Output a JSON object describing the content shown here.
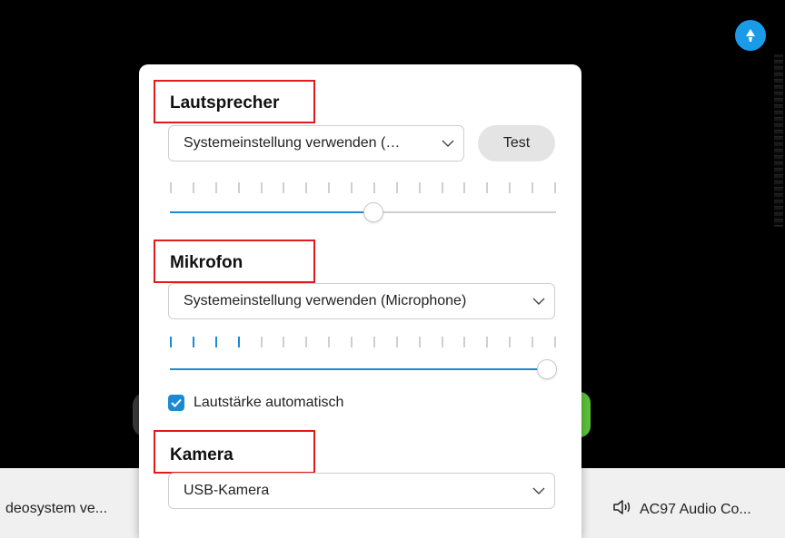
{
  "speaker": {
    "label": "Lautsprecher",
    "selected": "Systemeinstellung verwenden (…",
    "test_label": "Test",
    "volume_level": 0.54,
    "meter_active_bars": 0,
    "meter_total_bars": 18
  },
  "microphone": {
    "label": "Mikrofon",
    "selected": "Systemeinstellung verwenden (Microphone)",
    "volume_level": 1.0,
    "meter_active_bars": 4,
    "meter_total_bars": 18,
    "auto_volume_label": "Lautstärke automatisch",
    "auto_volume_checked": true
  },
  "camera": {
    "label": "Kamera",
    "selected": "USB-Kamera"
  },
  "bottom_bar": {
    "left_text": "deosystem ve...",
    "right_text": "AC97 Audio Co..."
  },
  "colors": {
    "accent": "#1a8ad4",
    "highlight_box": "#e01b1b",
    "badge": "#1a9be8"
  },
  "icons": [
    "chevron-down-icon",
    "speaker-icon",
    "checkmark-icon",
    "badge-icon"
  ]
}
